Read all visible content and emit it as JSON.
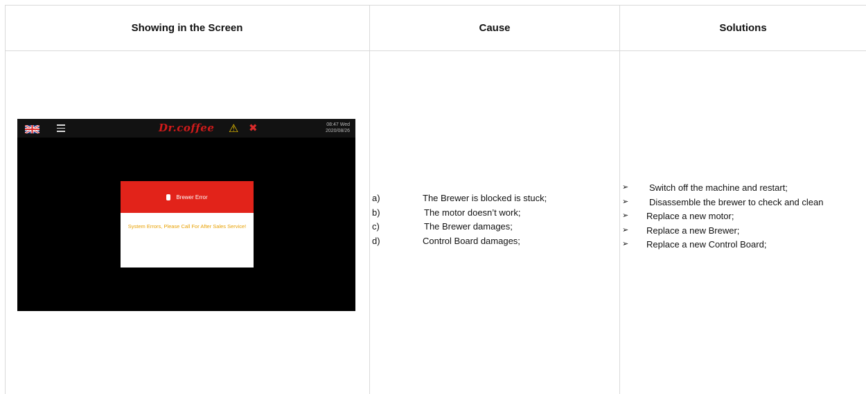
{
  "headers": {
    "screen": "Showing in the Screen",
    "cause": "Cause",
    "solutions": "Solutions"
  },
  "machine_screen": {
    "brand": "Dr.coffee",
    "time": "08:47 Wed",
    "date": "2020/08/26",
    "dialog_title": "Brewer Error",
    "dialog_message": "System Errors, Please Call For After Sales Service!",
    "icons": [
      "uk-flag-icon",
      "menu-icon",
      "warning-icon",
      "tools-icon"
    ]
  },
  "causes": [
    {
      "letter": "a)",
      "text": "The Brewer is blocked is stuck;"
    },
    {
      "letter": "b)",
      "text": "The motor doesn’t work;"
    },
    {
      "letter": "c)",
      "text": "The Brewer damages;"
    },
    {
      "letter": "d)",
      "text": "Control Board damages;"
    }
  ],
  "solutions": [
    {
      "bullet": "➢",
      "text": "Switch off the machine and restart;"
    },
    {
      "bullet": "➢",
      "text": "Disassemble the brewer to check and clean"
    },
    {
      "bullet": "➢",
      "text": "Replace a new motor;"
    },
    {
      "bullet": "➢",
      "text": "Replace a new Brewer;"
    },
    {
      "bullet": "➢",
      "text": "Replace a new Control Board;"
    }
  ],
  "colors": {
    "brand_red": "#d01a1a",
    "dialog_red": "#e2231a",
    "warning_yellow": "#e8c000",
    "message_orange": "#e8a000",
    "border": "#d9d9d9"
  }
}
